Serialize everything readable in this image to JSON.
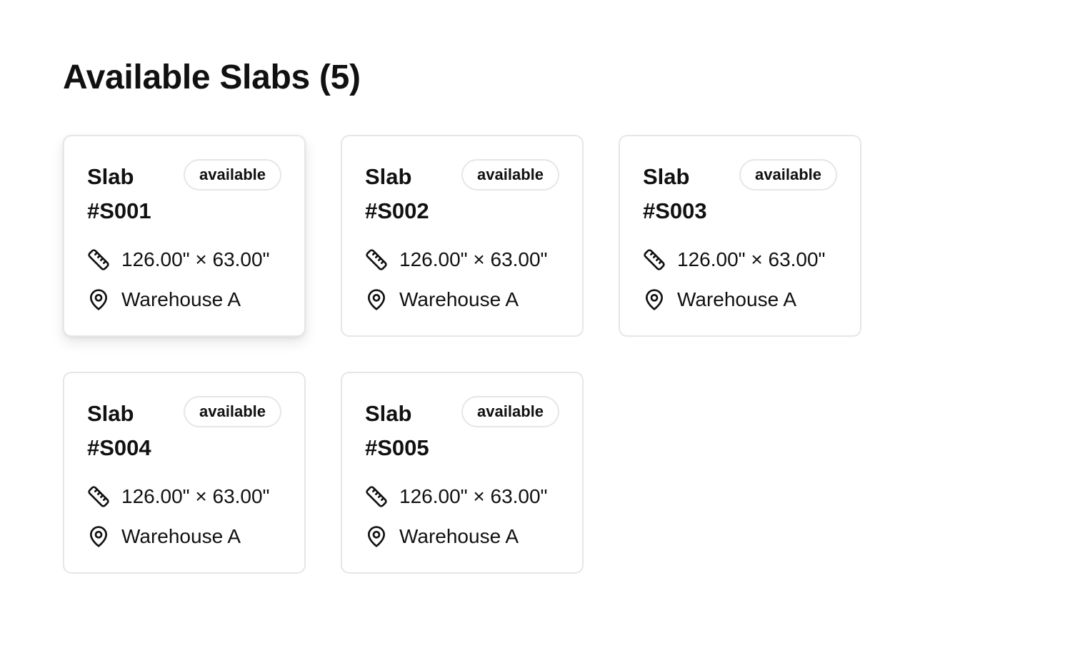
{
  "page": {
    "title": "Available Slabs (5)"
  },
  "slabs": [
    {
      "name": "Slab #S001",
      "status": "available",
      "dimensions": "126.00\" × 63.00\"",
      "location": "Warehouse A"
    },
    {
      "name": "Slab #S002",
      "status": "available",
      "dimensions": "126.00\" × 63.00\"",
      "location": "Warehouse A"
    },
    {
      "name": "Slab #S003",
      "status": "available",
      "dimensions": "126.00\" × 63.00\"",
      "location": "Warehouse A"
    },
    {
      "name": "Slab #S004",
      "status": "available",
      "dimensions": "126.00\" × 63.00\"",
      "location": "Warehouse A"
    },
    {
      "name": "Slab #S005",
      "status": "available",
      "dimensions": "126.00\" × 63.00\"",
      "location": "Warehouse A"
    }
  ],
  "icons": {
    "dimensions": "ruler-icon",
    "location": "map-pin-icon"
  },
  "colors": {
    "text": "#111111",
    "border": "#e6e6e6",
    "background": "#ffffff"
  }
}
